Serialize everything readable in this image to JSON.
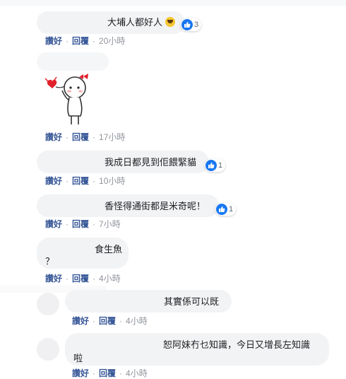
{
  "colors": {
    "link": "#385898",
    "bubble": "#f2f3f5",
    "like": "#1877f2",
    "time": "#90949c"
  },
  "actions": {
    "like": "讚好",
    "reply": "回覆",
    "sep": "·"
  },
  "comments": [
    {
      "text": "大埔人都好人",
      "emoji": "laughing-emoji",
      "reaction_count": "3",
      "time": "20小時"
    },
    {
      "sticker": "stickman-with-heart",
      "time": "17小時"
    },
    {
      "text": "我成日都見到佢餵緊貓",
      "reaction_count": "1",
      "time": "10小時"
    },
    {
      "text": "香怪得通街都是米奇呢！",
      "reaction_count": "1",
      "time": "7小時"
    },
    {
      "text_line1": "食生魚",
      "text_line2": "？",
      "time": "4小時"
    },
    {
      "text": "其實係可以既",
      "time": "4小時"
    },
    {
      "text_line1": "恕阿妹冇乜知識，今日又增長左知識",
      "text_line2": "啦",
      "time": "4小時"
    }
  ]
}
